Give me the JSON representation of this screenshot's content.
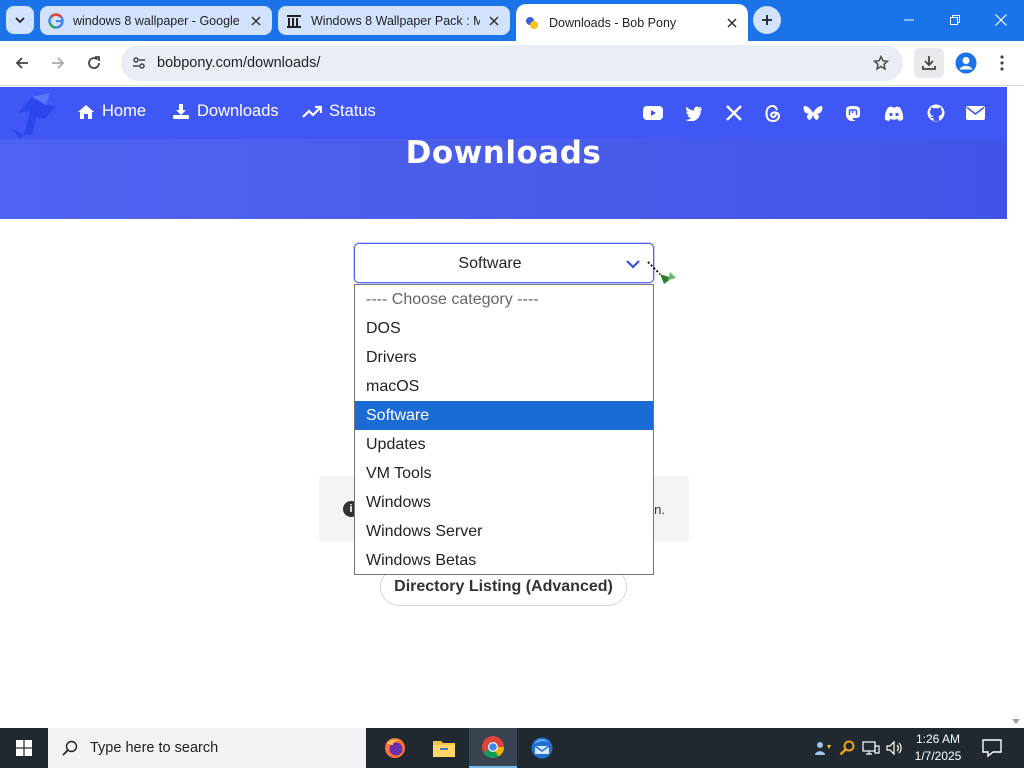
{
  "browser": {
    "tabs": [
      {
        "title": "windows 8 wallpaper - Google",
        "favicon": "google-icon",
        "active": false
      },
      {
        "title": "Windows 8 Wallpaper Pack : M",
        "favicon": "archive-icon",
        "active": false
      },
      {
        "title": "Downloads - Bob Pony",
        "favicon": "bobpony-icon",
        "active": true
      }
    ],
    "url": "bobpony.com/downloads/",
    "accent": "#1a73e8"
  },
  "nav": {
    "links": [
      {
        "label": "Home",
        "icon": "home-icon"
      },
      {
        "label": "Downloads",
        "icon": "download-icon"
      },
      {
        "label": "Status",
        "icon": "trend-icon"
      }
    ],
    "social_icons": [
      "youtube-icon",
      "twitter-icon",
      "x-icon",
      "threads-icon",
      "bluesky-icon",
      "mastodon-icon",
      "discord-icon",
      "github-icon",
      "email-icon"
    ],
    "bar_color": "#3f57f5"
  },
  "hero": {
    "title": "Downloads"
  },
  "category_select": {
    "value": "Software",
    "options": [
      "---- Choose category ----",
      "DOS",
      "Drivers",
      "macOS",
      "Software",
      "Updates",
      "VM Tools",
      "Windows",
      "Windows Server",
      "Windows Betas"
    ],
    "selected_color": "#1a6bd3"
  },
  "info": {
    "tail": "n."
  },
  "directory_button": {
    "label": "Directory Listing (Advanced)"
  },
  "taskbar": {
    "search_placeholder": "Type here to search",
    "apps": [
      "firefox-icon",
      "file-explorer-icon",
      "chrome-icon",
      "thunderbird-icon"
    ],
    "time": "1:26 AM",
    "date": "1/7/2025"
  }
}
